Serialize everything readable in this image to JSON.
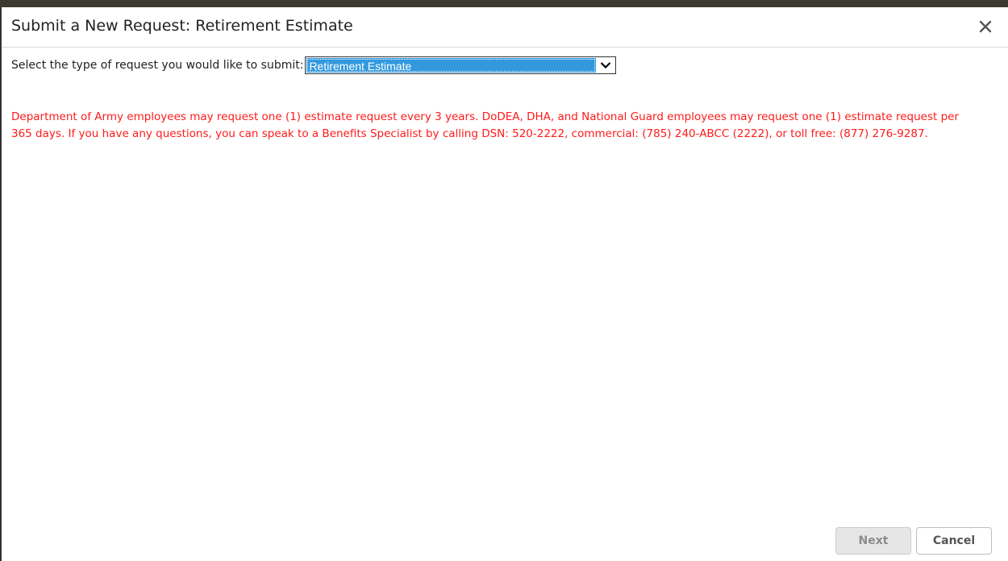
{
  "dialog": {
    "title": "Submit a New Request: Retirement Estimate"
  },
  "request_type": {
    "label": "Select the type of request you would like to submit:",
    "selected": "Retirement Estimate"
  },
  "notice": {
    "text": "Department of Army employees may request one (1) estimate request every 3 years.  DoDEA, DHA, and National Guard employees may request one (1) estimate request per 365 days.  If you have any questions, you can speak to a Benefits Specialist by calling DSN: 520-2222, commercial: (785) 240-ABCC (2222), or toll free: (877) 276-9287.",
    "color": "#ff1a1a"
  },
  "buttons": {
    "next": "Next",
    "cancel": "Cancel"
  },
  "icons": {
    "close": "close-icon",
    "dropdown": "chevron-down-icon"
  },
  "colors": {
    "selection_highlight": "#3399dd"
  }
}
